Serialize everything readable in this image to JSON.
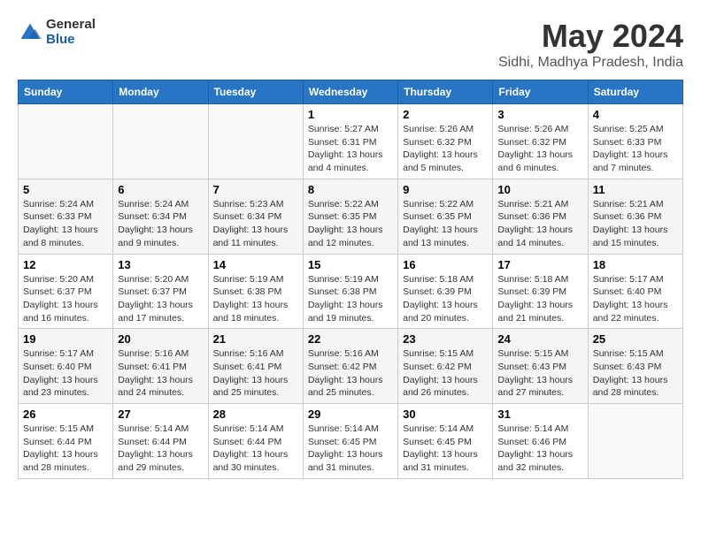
{
  "logo": {
    "general": "General",
    "blue": "Blue"
  },
  "title": "May 2024",
  "subtitle": "Sidhi, Madhya Pradesh, India",
  "headers": [
    "Sunday",
    "Monday",
    "Tuesday",
    "Wednesday",
    "Thursday",
    "Friday",
    "Saturday"
  ],
  "weeks": [
    [
      {
        "day": "",
        "sunrise": "",
        "sunset": "",
        "daylight": ""
      },
      {
        "day": "",
        "sunrise": "",
        "sunset": "",
        "daylight": ""
      },
      {
        "day": "",
        "sunrise": "",
        "sunset": "",
        "daylight": ""
      },
      {
        "day": "1",
        "sunrise": "Sunrise: 5:27 AM",
        "sunset": "Sunset: 6:31 PM",
        "daylight": "Daylight: 13 hours and 4 minutes."
      },
      {
        "day": "2",
        "sunrise": "Sunrise: 5:26 AM",
        "sunset": "Sunset: 6:32 PM",
        "daylight": "Daylight: 13 hours and 5 minutes."
      },
      {
        "day": "3",
        "sunrise": "Sunrise: 5:26 AM",
        "sunset": "Sunset: 6:32 PM",
        "daylight": "Daylight: 13 hours and 6 minutes."
      },
      {
        "day": "4",
        "sunrise": "Sunrise: 5:25 AM",
        "sunset": "Sunset: 6:33 PM",
        "daylight": "Daylight: 13 hours and 7 minutes."
      }
    ],
    [
      {
        "day": "5",
        "sunrise": "Sunrise: 5:24 AM",
        "sunset": "Sunset: 6:33 PM",
        "daylight": "Daylight: 13 hours and 8 minutes."
      },
      {
        "day": "6",
        "sunrise": "Sunrise: 5:24 AM",
        "sunset": "Sunset: 6:34 PM",
        "daylight": "Daylight: 13 hours and 9 minutes."
      },
      {
        "day": "7",
        "sunrise": "Sunrise: 5:23 AM",
        "sunset": "Sunset: 6:34 PM",
        "daylight": "Daylight: 13 hours and 11 minutes."
      },
      {
        "day": "8",
        "sunrise": "Sunrise: 5:22 AM",
        "sunset": "Sunset: 6:35 PM",
        "daylight": "Daylight: 13 hours and 12 minutes."
      },
      {
        "day": "9",
        "sunrise": "Sunrise: 5:22 AM",
        "sunset": "Sunset: 6:35 PM",
        "daylight": "Daylight: 13 hours and 13 minutes."
      },
      {
        "day": "10",
        "sunrise": "Sunrise: 5:21 AM",
        "sunset": "Sunset: 6:36 PM",
        "daylight": "Daylight: 13 hours and 14 minutes."
      },
      {
        "day": "11",
        "sunrise": "Sunrise: 5:21 AM",
        "sunset": "Sunset: 6:36 PM",
        "daylight": "Daylight: 13 hours and 15 minutes."
      }
    ],
    [
      {
        "day": "12",
        "sunrise": "Sunrise: 5:20 AM",
        "sunset": "Sunset: 6:37 PM",
        "daylight": "Daylight: 13 hours and 16 minutes."
      },
      {
        "day": "13",
        "sunrise": "Sunrise: 5:20 AM",
        "sunset": "Sunset: 6:37 PM",
        "daylight": "Daylight: 13 hours and 17 minutes."
      },
      {
        "day": "14",
        "sunrise": "Sunrise: 5:19 AM",
        "sunset": "Sunset: 6:38 PM",
        "daylight": "Daylight: 13 hours and 18 minutes."
      },
      {
        "day": "15",
        "sunrise": "Sunrise: 5:19 AM",
        "sunset": "Sunset: 6:38 PM",
        "daylight": "Daylight: 13 hours and 19 minutes."
      },
      {
        "day": "16",
        "sunrise": "Sunrise: 5:18 AM",
        "sunset": "Sunset: 6:39 PM",
        "daylight": "Daylight: 13 hours and 20 minutes."
      },
      {
        "day": "17",
        "sunrise": "Sunrise: 5:18 AM",
        "sunset": "Sunset: 6:39 PM",
        "daylight": "Daylight: 13 hours and 21 minutes."
      },
      {
        "day": "18",
        "sunrise": "Sunrise: 5:17 AM",
        "sunset": "Sunset: 6:40 PM",
        "daylight": "Daylight: 13 hours and 22 minutes."
      }
    ],
    [
      {
        "day": "19",
        "sunrise": "Sunrise: 5:17 AM",
        "sunset": "Sunset: 6:40 PM",
        "daylight": "Daylight: 13 hours and 23 minutes."
      },
      {
        "day": "20",
        "sunrise": "Sunrise: 5:16 AM",
        "sunset": "Sunset: 6:41 PM",
        "daylight": "Daylight: 13 hours and 24 minutes."
      },
      {
        "day": "21",
        "sunrise": "Sunrise: 5:16 AM",
        "sunset": "Sunset: 6:41 PM",
        "daylight": "Daylight: 13 hours and 25 minutes."
      },
      {
        "day": "22",
        "sunrise": "Sunrise: 5:16 AM",
        "sunset": "Sunset: 6:42 PM",
        "daylight": "Daylight: 13 hours and 25 minutes."
      },
      {
        "day": "23",
        "sunrise": "Sunrise: 5:15 AM",
        "sunset": "Sunset: 6:42 PM",
        "daylight": "Daylight: 13 hours and 26 minutes."
      },
      {
        "day": "24",
        "sunrise": "Sunrise: 5:15 AM",
        "sunset": "Sunset: 6:43 PM",
        "daylight": "Daylight: 13 hours and 27 minutes."
      },
      {
        "day": "25",
        "sunrise": "Sunrise: 5:15 AM",
        "sunset": "Sunset: 6:43 PM",
        "daylight": "Daylight: 13 hours and 28 minutes."
      }
    ],
    [
      {
        "day": "26",
        "sunrise": "Sunrise: 5:15 AM",
        "sunset": "Sunset: 6:44 PM",
        "daylight": "Daylight: 13 hours and 28 minutes."
      },
      {
        "day": "27",
        "sunrise": "Sunrise: 5:14 AM",
        "sunset": "Sunset: 6:44 PM",
        "daylight": "Daylight: 13 hours and 29 minutes."
      },
      {
        "day": "28",
        "sunrise": "Sunrise: 5:14 AM",
        "sunset": "Sunset: 6:44 PM",
        "daylight": "Daylight: 13 hours and 30 minutes."
      },
      {
        "day": "29",
        "sunrise": "Sunrise: 5:14 AM",
        "sunset": "Sunset: 6:45 PM",
        "daylight": "Daylight: 13 hours and 31 minutes."
      },
      {
        "day": "30",
        "sunrise": "Sunrise: 5:14 AM",
        "sunset": "Sunset: 6:45 PM",
        "daylight": "Daylight: 13 hours and 31 minutes."
      },
      {
        "day": "31",
        "sunrise": "Sunrise: 5:14 AM",
        "sunset": "Sunset: 6:46 PM",
        "daylight": "Daylight: 13 hours and 32 minutes."
      },
      {
        "day": "",
        "sunrise": "",
        "sunset": "",
        "daylight": ""
      }
    ]
  ]
}
